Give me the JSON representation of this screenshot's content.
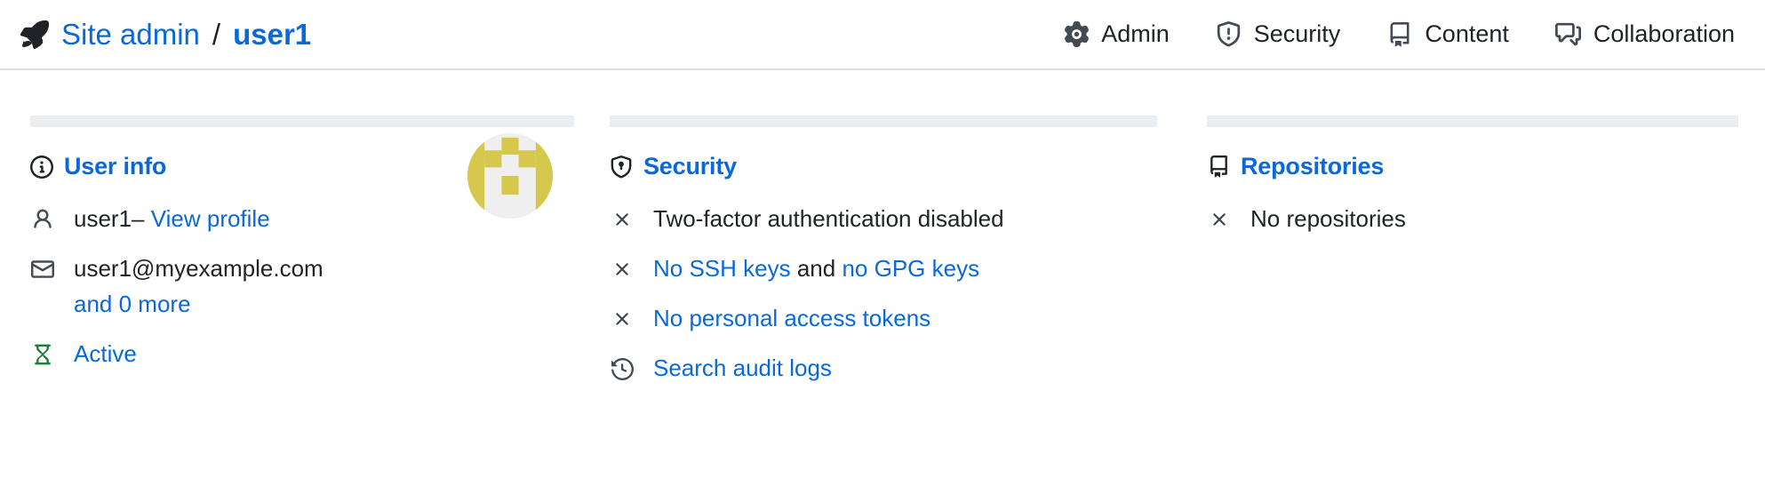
{
  "header": {
    "rocket_icon": "rocket-icon",
    "breadcrumb_root": "Site admin",
    "breadcrumb_separator": "/",
    "breadcrumb_current": "user1",
    "nav": [
      {
        "label": "Admin",
        "icon": "gear-icon"
      },
      {
        "label": "Security",
        "icon": "shield-check-icon"
      },
      {
        "label": "Content",
        "icon": "repo-icon"
      },
      {
        "label": "Collaboration",
        "icon": "comment-discussion-icon"
      }
    ]
  },
  "user_info": {
    "icon": "info-icon",
    "title": "User info",
    "avatar_alt": "user1 avatar",
    "rows": {
      "username": {
        "icon": "person-icon",
        "name": "user1",
        "dash": "–",
        "link": "View profile"
      },
      "email": {
        "icon": "mail-icon",
        "address": "user1@myexample.com",
        "more_link": "and 0 more"
      },
      "status": {
        "icon": "hourglass-icon",
        "label": "Active"
      }
    }
  },
  "security": {
    "icon": "shield-lock-icon",
    "title": "Security",
    "items": [
      {
        "icon": "x-icon",
        "text": "Two-factor authentication disabled"
      },
      {
        "icon": "x-icon",
        "link1": "No SSH keys",
        "joiner": "and",
        "link2": "no GPG keys"
      },
      {
        "icon": "x-icon",
        "link": "No personal access tokens"
      },
      {
        "icon": "history-icon",
        "link": "Search audit logs"
      }
    ]
  },
  "repositories": {
    "icon": "repo-icon",
    "title": "Repositories",
    "items": [
      {
        "icon": "x-icon",
        "text": "No repositories"
      }
    ]
  },
  "colors": {
    "link": "#0969da",
    "text": "#1f2328",
    "muted_icon": "#424a53",
    "success": "#1a7f37",
    "divider": "#eaeef0",
    "border": "#d8dee4",
    "avatar_bg": "#efefef",
    "avatar_fg": "#d5c84d"
  }
}
